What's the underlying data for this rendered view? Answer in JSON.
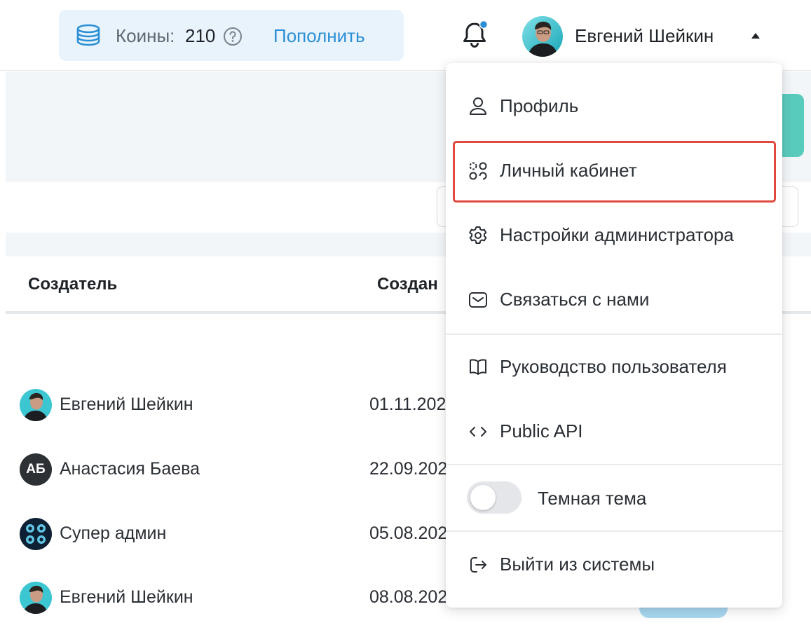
{
  "topbar": {
    "coins_label": "Коины:",
    "coins_value": "210",
    "topup_label": "Пополнить",
    "user_name": "Евгений Шейкин",
    "notification_dot_color": "#2b8fd6"
  },
  "table": {
    "columns": [
      "Создатель",
      "Создан"
    ],
    "rows": [
      {
        "creator": "Евгений Шейкин",
        "date": "01.11.202",
        "avatar": "photo"
      },
      {
        "creator": "Анастасия Баева",
        "date": "22.09.202",
        "avatar": "initials",
        "initials": "АБ"
      },
      {
        "creator": "Супер админ",
        "date": "05.08.202",
        "avatar": "logo"
      },
      {
        "creator": "Евгений Шейкин",
        "date": "08.08.202",
        "avatar": "photo"
      }
    ]
  },
  "menu": {
    "items": [
      {
        "label": "Профиль",
        "icon": "user-icon"
      },
      {
        "label": "Личный кабинет",
        "icon": "dashboard-icon",
        "highlighted": true
      },
      {
        "label": "Настройки администратора",
        "icon": "gear-icon"
      },
      {
        "label": "Связаться с нами",
        "icon": "mail-icon"
      },
      {
        "label": "Руководство пользователя",
        "icon": "book-icon"
      },
      {
        "label": "Public API",
        "icon": "code-icon"
      },
      {
        "label": "Выйти из системы",
        "icon": "logout-icon"
      }
    ],
    "dark_theme_label": "Темная тема",
    "dark_theme_on": false
  },
  "colors": {
    "accent": "#2b8fd6",
    "teal": "#59cbbd",
    "highlight": "#e2483e"
  }
}
